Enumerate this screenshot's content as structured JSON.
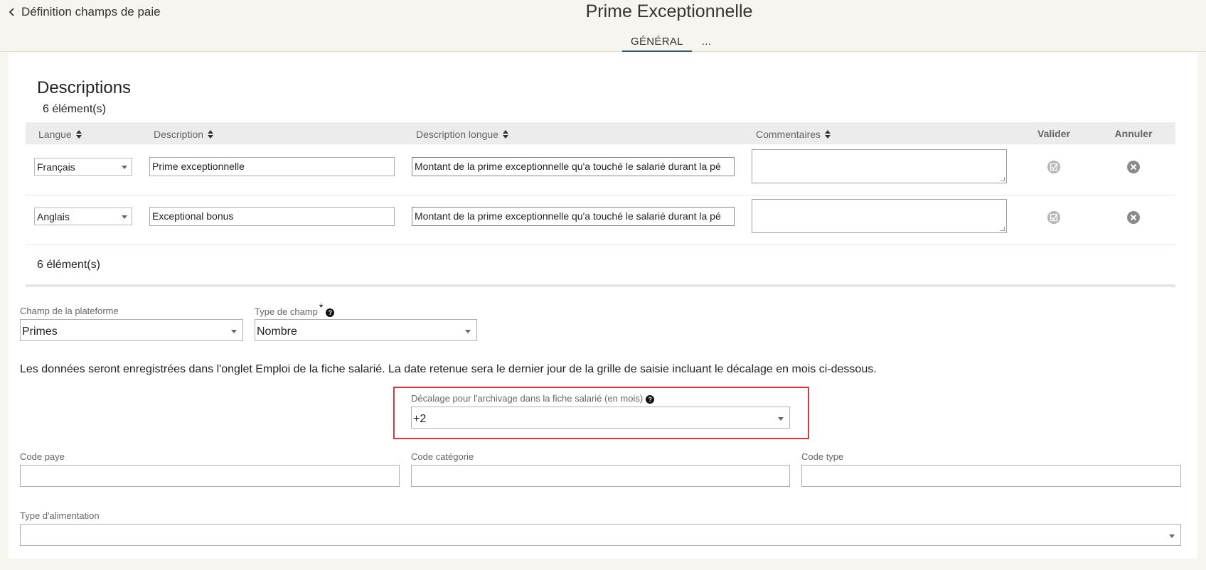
{
  "header": {
    "back_label": "Définition champs de paie",
    "title": "Prime Exceptionnelle",
    "tabs": [
      {
        "label": "GÉNÉRAL",
        "active": true
      },
      {
        "label": "..."
      }
    ]
  },
  "descriptions": {
    "title": "Descriptions",
    "count_top": "6 élément(s)",
    "count_bottom": "6 élément(s)",
    "columns": {
      "langue": "Langue",
      "description": "Description",
      "description_longue": "Description longue",
      "commentaires": "Commentaires",
      "valider": "Valider",
      "annuler": "Annuler"
    },
    "rows": [
      {
        "langue": "Français",
        "description": "Prime exceptionnelle",
        "description_longue": "Montant de la prime exceptionnelle qu'a touché le salarié durant la pé",
        "commentaires": ""
      },
      {
        "langue": "Anglais",
        "description": "Exceptional bonus",
        "description_longue": "Montant de la prime exceptionnelle qu'a touché le salarié durant la pé",
        "commentaires": ""
      }
    ]
  },
  "form": {
    "champ_plateforme": {
      "label": "Champ de la plateforme",
      "value": "Primes"
    },
    "type_champ": {
      "label": "Type de champ",
      "required_mark": "*",
      "value": "Nombre"
    },
    "info": "Les données seront enregistrées dans l'onglet Emploi de la fiche salarié. La date retenue sera le dernier jour de la grille de saisie incluant le décalage en mois ci-dessous.",
    "decalage": {
      "label": "Décalage pour l'archivage dans la fiche salarié (en mois)",
      "value": "+2"
    },
    "code_paye": {
      "label": "Code paye",
      "value": ""
    },
    "code_categorie": {
      "label": "Code catégorie",
      "value": ""
    },
    "code_type": {
      "label": "Code type",
      "value": ""
    },
    "type_alimentation": {
      "label": "Type d'alimentation",
      "value": ""
    }
  },
  "colors": {
    "accent": "#3c5a6e",
    "highlight_border": "#d9363e",
    "background": "#f7f5ef"
  }
}
